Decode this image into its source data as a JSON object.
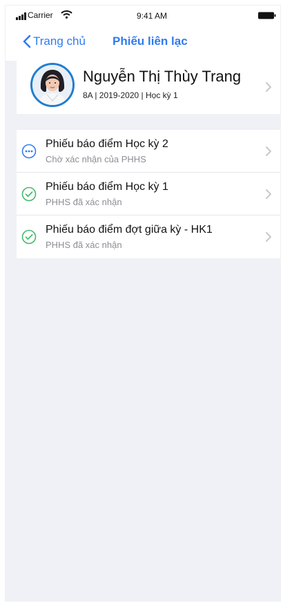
{
  "status_bar": {
    "carrier": "Carrier",
    "time": "9:41 AM",
    "icons": [
      "signal-bars-icon",
      "wifi-icon",
      "battery-icon"
    ]
  },
  "navbar": {
    "back_label": "Trang chủ",
    "title": "Phiếu liên lạc",
    "accent": "#2f7bf1"
  },
  "profile": {
    "name": "Nguyễn Thị Thùy Trang",
    "meta": "8A | 2019-2020 | Học kỳ 1",
    "avatar_ring_color": "#1f7ed0"
  },
  "reports": [
    {
      "title": "Phiếu báo điểm Học kỳ 2",
      "status": "Chờ xác nhận của PHHS",
      "icon": "pending-ellipsis-icon",
      "icon_color": "#2f7bf1"
    },
    {
      "title": "Phiếu báo điểm Học kỳ 1",
      "status": "PHHS đã xác nhận",
      "icon": "check-circle-icon",
      "icon_color": "#43b96a"
    },
    {
      "title": "Phiếu báo điểm đợt giữa kỳ - HK1",
      "status": "PHHS đã xác nhận",
      "icon": "check-circle-icon",
      "icon_color": "#43b96a"
    }
  ]
}
